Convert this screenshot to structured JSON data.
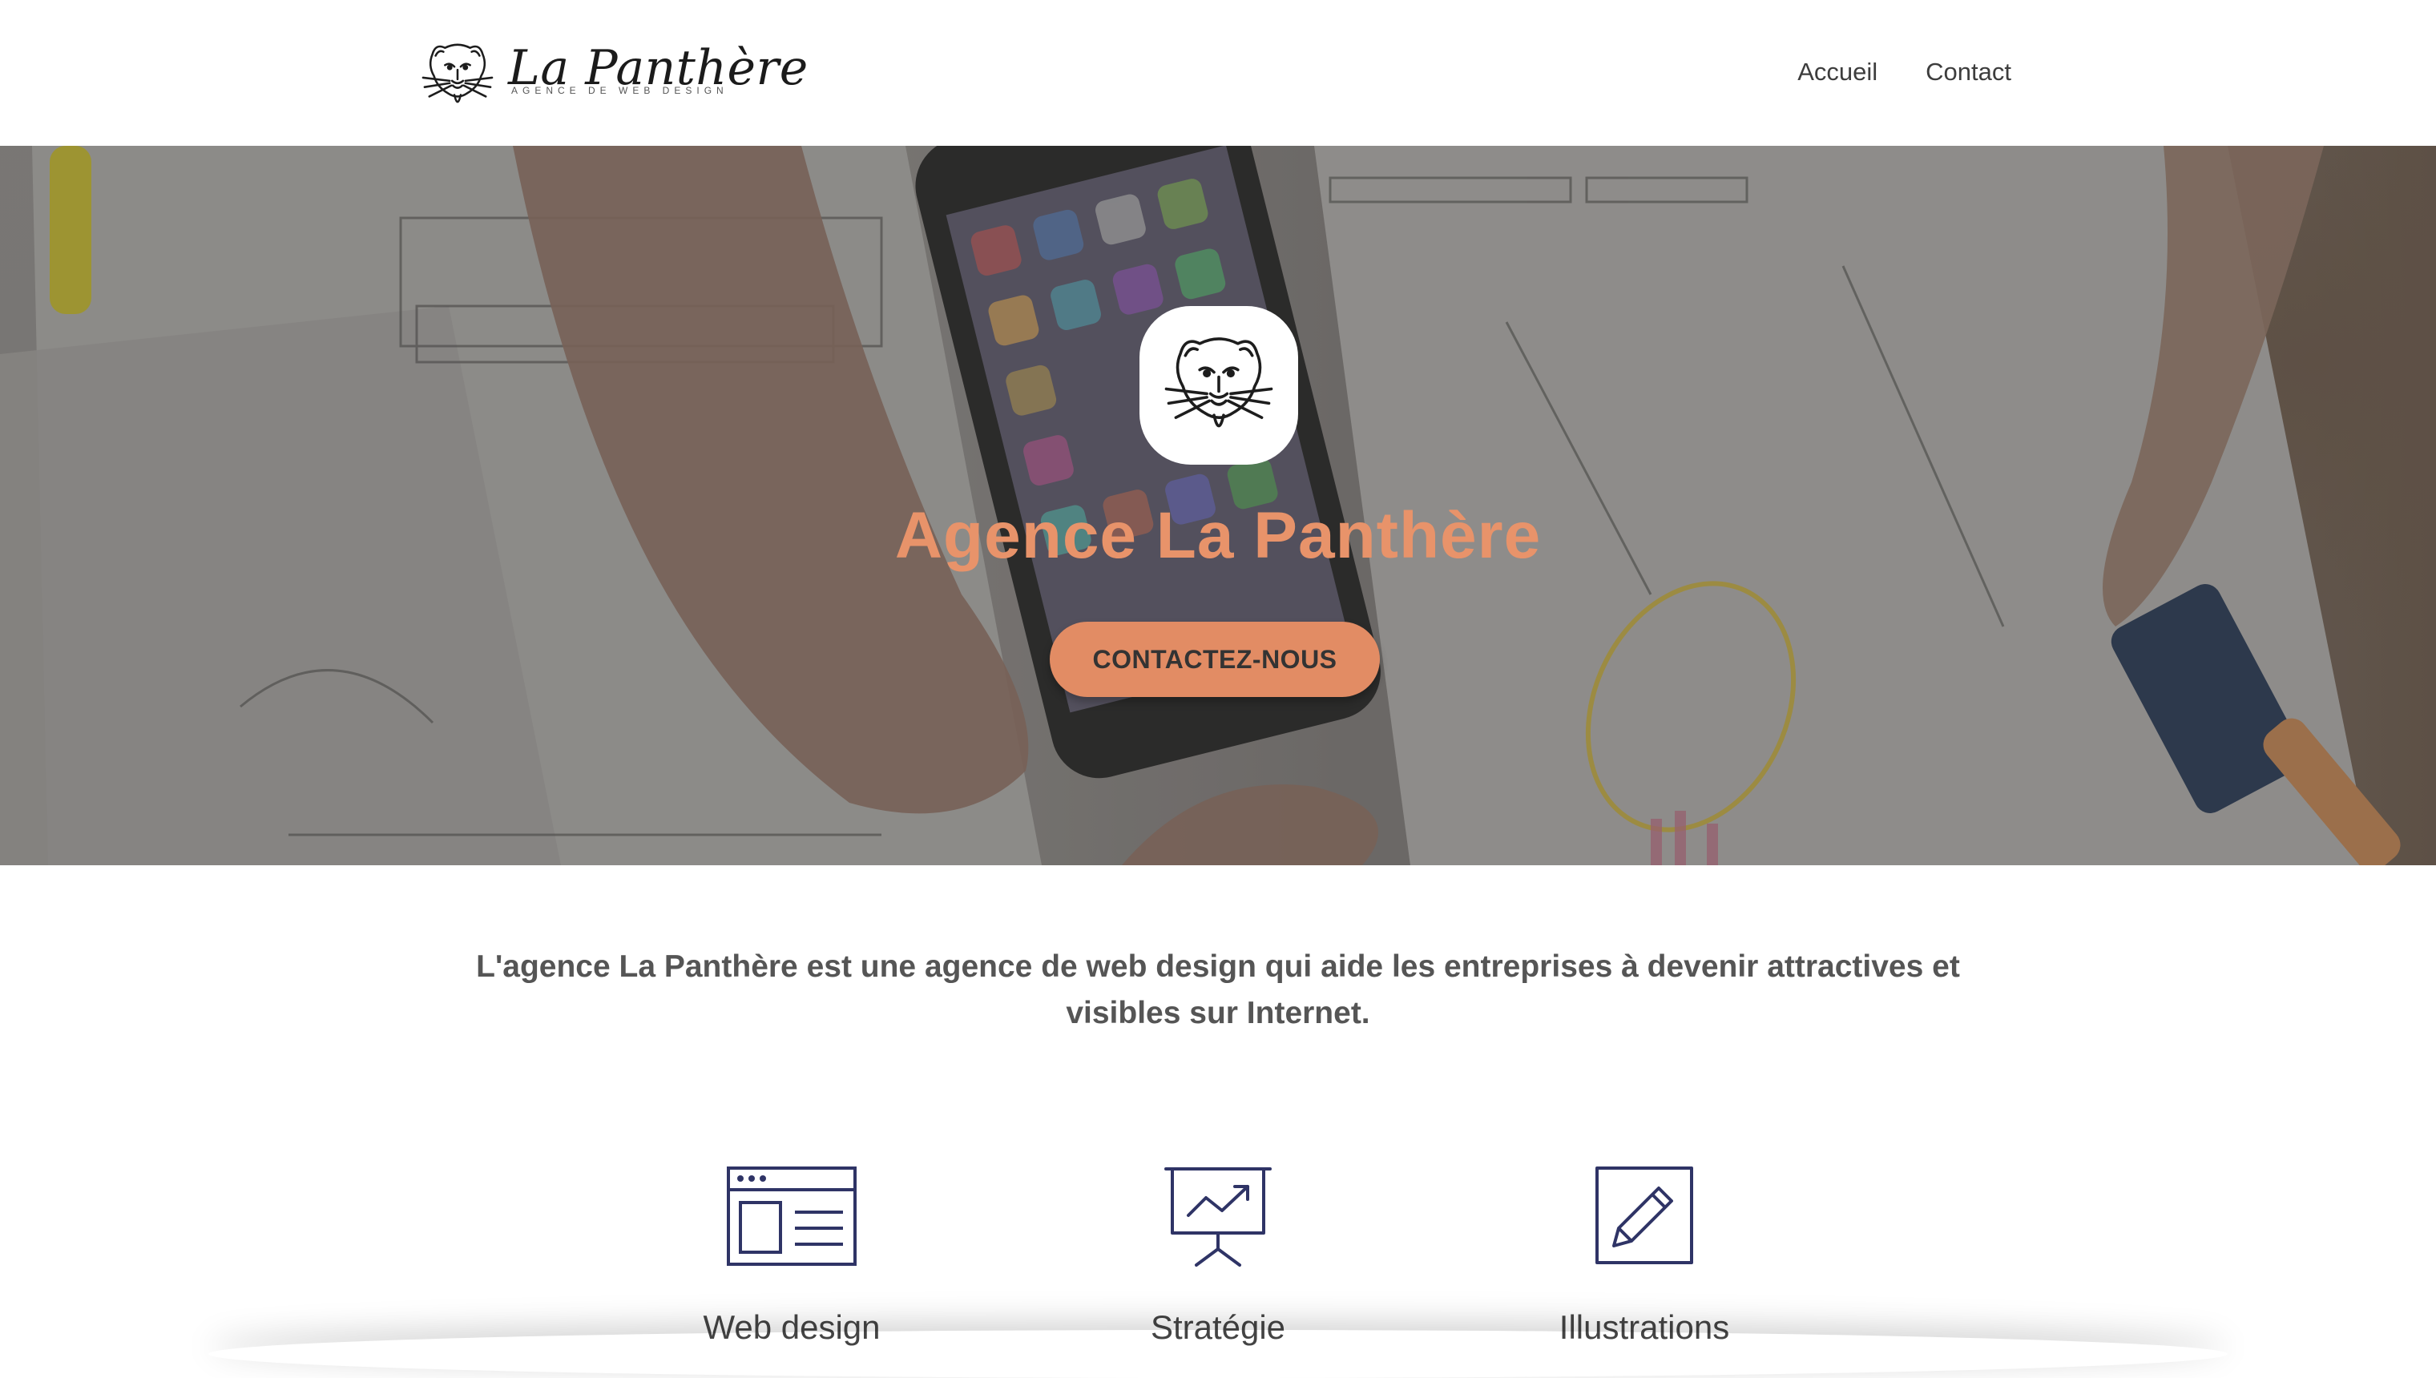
{
  "header": {
    "logo": {
      "name": "La Panthère",
      "tagline": "AGENCE DE WEB DESIGN",
      "icon": "panther-head-icon"
    },
    "nav": [
      {
        "label": "Accueil"
      },
      {
        "label": "Contact"
      }
    ]
  },
  "hero": {
    "icon": "panther-head-icon",
    "title": "Agence La Panthère",
    "cta_label": "CONTACTEZ-NOUS"
  },
  "intro": {
    "text": "L'agence La Panthère est une agence de web design qui aide les entreprises à devenir attractives et visibles sur Internet."
  },
  "services": [
    {
      "label": "Web design",
      "icon": "browser-layout-icon"
    },
    {
      "label": "Stratégie",
      "icon": "presentation-chart-icon"
    },
    {
      "label": "Illustrations",
      "icon": "pencil-square-icon"
    }
  ],
  "colors": {
    "accent": "#e8936a",
    "button": "#e28c64",
    "icon_stroke": "#2f3466",
    "text": "#444444"
  }
}
